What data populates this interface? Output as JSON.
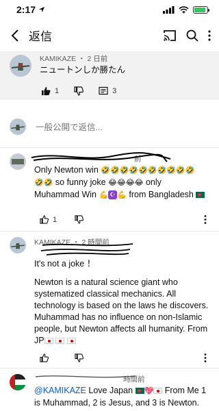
{
  "status": {
    "time": "2:17"
  },
  "header": {
    "title": "返信"
  },
  "parent": {
    "author": "KAMIKAZE",
    "time": "2 日前",
    "text": "ニュートンしか勝たん",
    "likes": "1",
    "replies": "3"
  },
  "reply_input": {
    "placeholder": "一般公開で返信..."
  },
  "replies": [
    {
      "time_tail": "前",
      "line1": "Only Newton win",
      "line2_tail": "so funny joke",
      "line2_end": "only",
      "line3_a": "Muhammad Win",
      "line3_b": "from Bangladesh",
      "likes": "1"
    },
    {
      "author": "KAMIKAZE",
      "time": "2 時間前",
      "p1": "It's not a joke ！",
      "p2": "Newton is a natural science giant who systematized classical mechanics.  All technology is based on the laws he discovers.  Muhammad has no influence on non-Islamic people, but Newton affects all humanity.  From JP"
    },
    {
      "time_tail": "時間前",
      "mention": "@KAMIKAZE",
      "t1": "Love Japan",
      "t2": "From Me 1 is Muhammad, 2 is Jesus, and 3 is Newton."
    }
  ],
  "colors": {
    "accent": "#065fd4",
    "meta": "#606060",
    "bg_parent": "#f2f2f2"
  }
}
